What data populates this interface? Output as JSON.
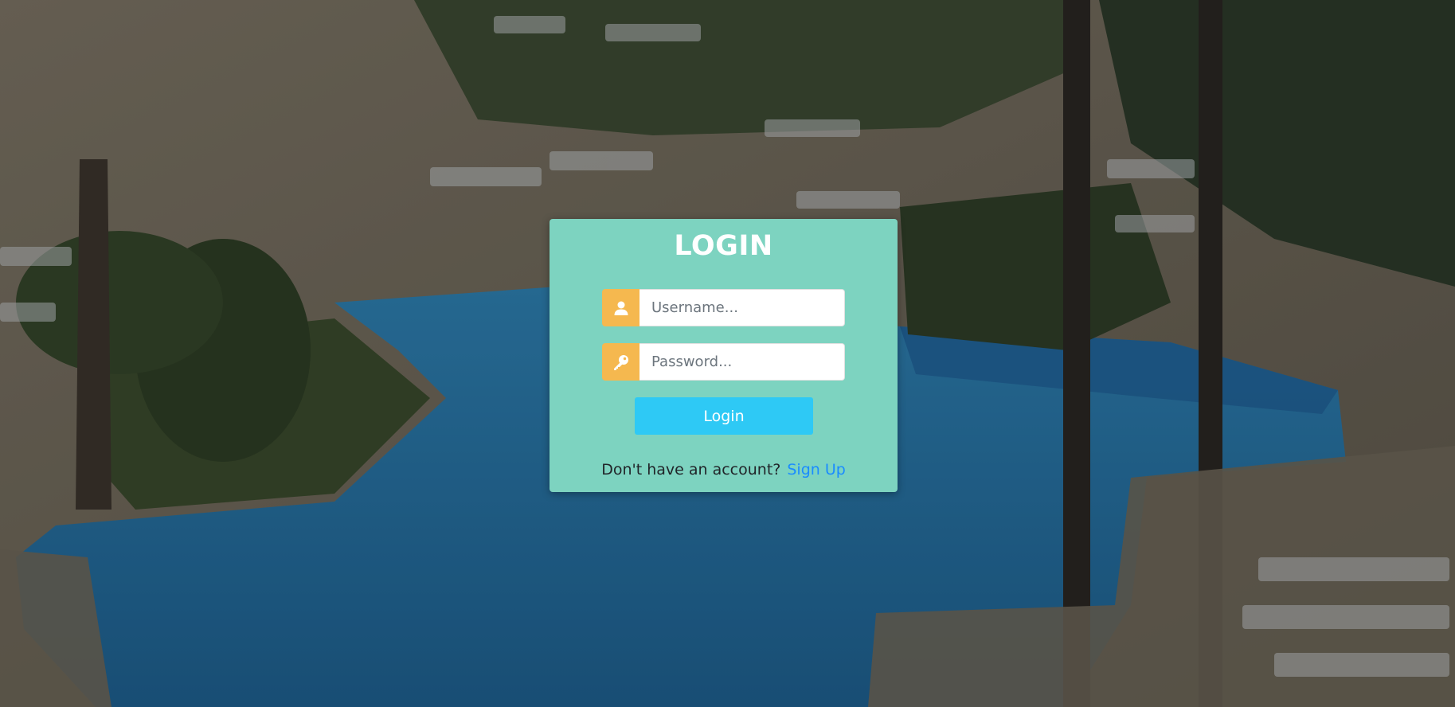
{
  "login_form": {
    "title": "LOGIN",
    "username": {
      "placeholder": "Username...",
      "value": "",
      "icon": "user-icon"
    },
    "password": {
      "placeholder": "Password...",
      "value": "",
      "icon": "key-icon"
    },
    "submit_label": "Login",
    "signup_prompt": "Don't have an account?",
    "signup_link_label": "Sign Up"
  },
  "colors": {
    "card_background": "#7dd3c0",
    "icon_addon": "#f5b84f",
    "login_button": "#2ec9f5",
    "signup_link": "#1a8cff"
  }
}
